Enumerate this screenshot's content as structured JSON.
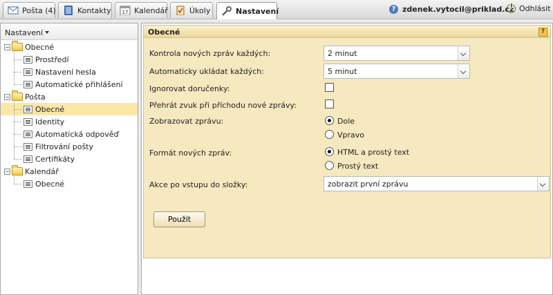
{
  "tabs": [
    {
      "label": "Pošta (4)",
      "icon": "mail-icon"
    },
    {
      "label": "Kontakty",
      "icon": "contacts-icon"
    },
    {
      "label": "Kalendář",
      "icon": "calendar-icon",
      "day": "17"
    },
    {
      "label": "Úkoly",
      "icon": "tasks-icon"
    },
    {
      "label": "Nastavení",
      "icon": "wrench-icon",
      "active": true
    }
  ],
  "user": {
    "email": "zdenek.vytocil@priklad.cz",
    "help": "?"
  },
  "logout_label": "Odhlásit",
  "sidebar": {
    "title": "Nastavení",
    "tree": [
      {
        "label": "Obecné",
        "type": "folder",
        "level": 0,
        "expander": "−"
      },
      {
        "label": "Prostředí",
        "type": "leaf",
        "level": 1
      },
      {
        "label": "Nastavení hesla",
        "type": "leaf",
        "level": 1
      },
      {
        "label": "Automatické přihlášení",
        "type": "leaf",
        "level": 1
      },
      {
        "label": "Pošta",
        "type": "folder",
        "level": 0,
        "expander": "−"
      },
      {
        "label": "Obecné",
        "type": "leaf",
        "level": 1,
        "selected": true
      },
      {
        "label": "Identity",
        "type": "leaf",
        "level": 1
      },
      {
        "label": "Automatická odpověď",
        "type": "leaf",
        "level": 1
      },
      {
        "label": "Filtrování pošty",
        "type": "leaf",
        "level": 1
      },
      {
        "label": "Certifikáty",
        "type": "leaf",
        "level": 1
      },
      {
        "label": "Kalendář",
        "type": "folder",
        "level": 0,
        "expander": "−"
      },
      {
        "label": "Obecné",
        "type": "leaf",
        "level": 1
      }
    ]
  },
  "panel": {
    "title": "Obecné",
    "help": "?",
    "fields": {
      "check_interval": {
        "label": "Kontrola nových zpráv každých:",
        "value": "2 minut"
      },
      "autosave": {
        "label": "Automaticky ukládat každých:",
        "value": "5 minut"
      },
      "ignore_receipts": {
        "label": "Ignorovat doručenky:",
        "checked": false
      },
      "sound": {
        "label": "Přehrát zvuk při příchodu nové zprávy:",
        "checked": false
      },
      "show_message": {
        "label": "Zobrazovat zprávu:",
        "options": [
          "Dole",
          "Vpravo"
        ],
        "selected": "Dole"
      },
      "format": {
        "label": "Formát nových zpráv:",
        "options": [
          "HTML a prostý text",
          "Prostý text"
        ],
        "selected": "HTML a prostý text"
      },
      "folder_action": {
        "label": "Akce po vstupu do složky:",
        "value": "zobrazit první zprávu"
      }
    },
    "apply_label": "Použít"
  },
  "colors": {
    "selected_row": "#fce7a6",
    "panel_bg": "#f6e8bf",
    "accent": "#4a78c2"
  }
}
